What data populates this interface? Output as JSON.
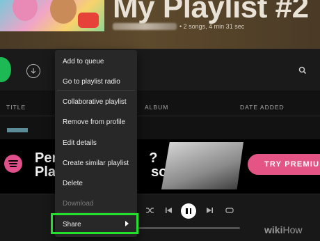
{
  "playlist": {
    "title": "My Playlist #2",
    "meta": "• 2 songs, 4 min 31 sec"
  },
  "table": {
    "columns": [
      "TITLE",
      "ALBUM",
      "DATE ADDED"
    ]
  },
  "ad": {
    "line1": "Per",
    "line1_tail": "?",
    "line2": "Play",
    "line2_tail": "song.",
    "cta": "TRY PREMIU"
  },
  "context_menu": {
    "items": [
      {
        "label": "Add to queue"
      },
      {
        "label": "Go to playlist radio"
      },
      {
        "label": "Collaborative playlist"
      },
      {
        "label": "Remove from profile"
      },
      {
        "label": "Edit details"
      },
      {
        "label": "Create similar playlist"
      },
      {
        "label": "Delete"
      },
      {
        "label": "Download",
        "disabled": true
      },
      {
        "label": "Share",
        "has_submenu": true,
        "highlighted": true
      }
    ]
  },
  "watermark": {
    "bold": "wiki",
    "regular": "How"
  },
  "colors": {
    "accent_green": "#1db954",
    "premium_pink": "#e45586",
    "highlight_green": "#23e02b",
    "menu_bg": "#282828"
  },
  "icons": [
    "download-icon",
    "search-icon",
    "shuffle-icon",
    "previous-icon",
    "pause-icon",
    "next-icon",
    "repeat-icon",
    "spotify-logo-icon",
    "chevron-right-icon"
  ]
}
